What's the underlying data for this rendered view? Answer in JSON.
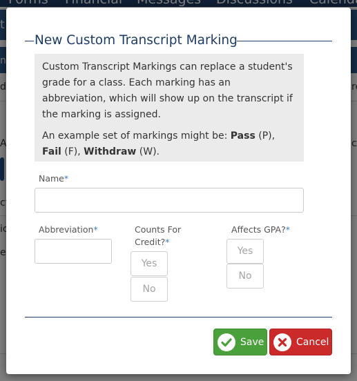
{
  "background": {
    "nav_items": [
      "Forms",
      "Financial",
      "Messages",
      "Discussions",
      "Calendar"
    ],
    "fragments": [
      "t",
      "n",
      "di",
      "re",
      "A",
      "ct",
      "ic",
      "ee",
      "cu"
    ]
  },
  "modal": {
    "title": "New Custom Transcript Marking",
    "info": {
      "paragraph1": "Custom Transcript Markings can replace a student's grade for a class. Each marking has an abbreviation, which will show up on the transcript if the marking is assigned.",
      "example_prefix": "An example set of markings might be: ",
      "pass_name": "Pass",
      "pass_abbr": " (P), ",
      "fail_name": "Fail",
      "fail_abbr": " (F), ",
      "withdraw_name": "Withdraw",
      "withdraw_abbr": " (W)."
    },
    "fields": {
      "name_label": "Name",
      "name_value": "",
      "abbreviation_label": "Abbreviation",
      "abbreviation_value": "",
      "counts_label_line1": "Counts For",
      "counts_label_line2": "Credit?",
      "counts_yes": "Yes",
      "counts_no": "No",
      "gpa_label": "Affects GPA?",
      "gpa_yes": "Yes",
      "gpa_no": "No",
      "required_mark": "*"
    },
    "buttons": {
      "save": "Save",
      "cancel": "Cancel"
    }
  },
  "colors": {
    "title": "#1e3c64",
    "save": "#4aa13b",
    "cancel": "#cb2a2a",
    "required": "#3b7fc4"
  },
  "icons": {
    "save": "check-circle-icon",
    "cancel": "x-circle-icon"
  }
}
